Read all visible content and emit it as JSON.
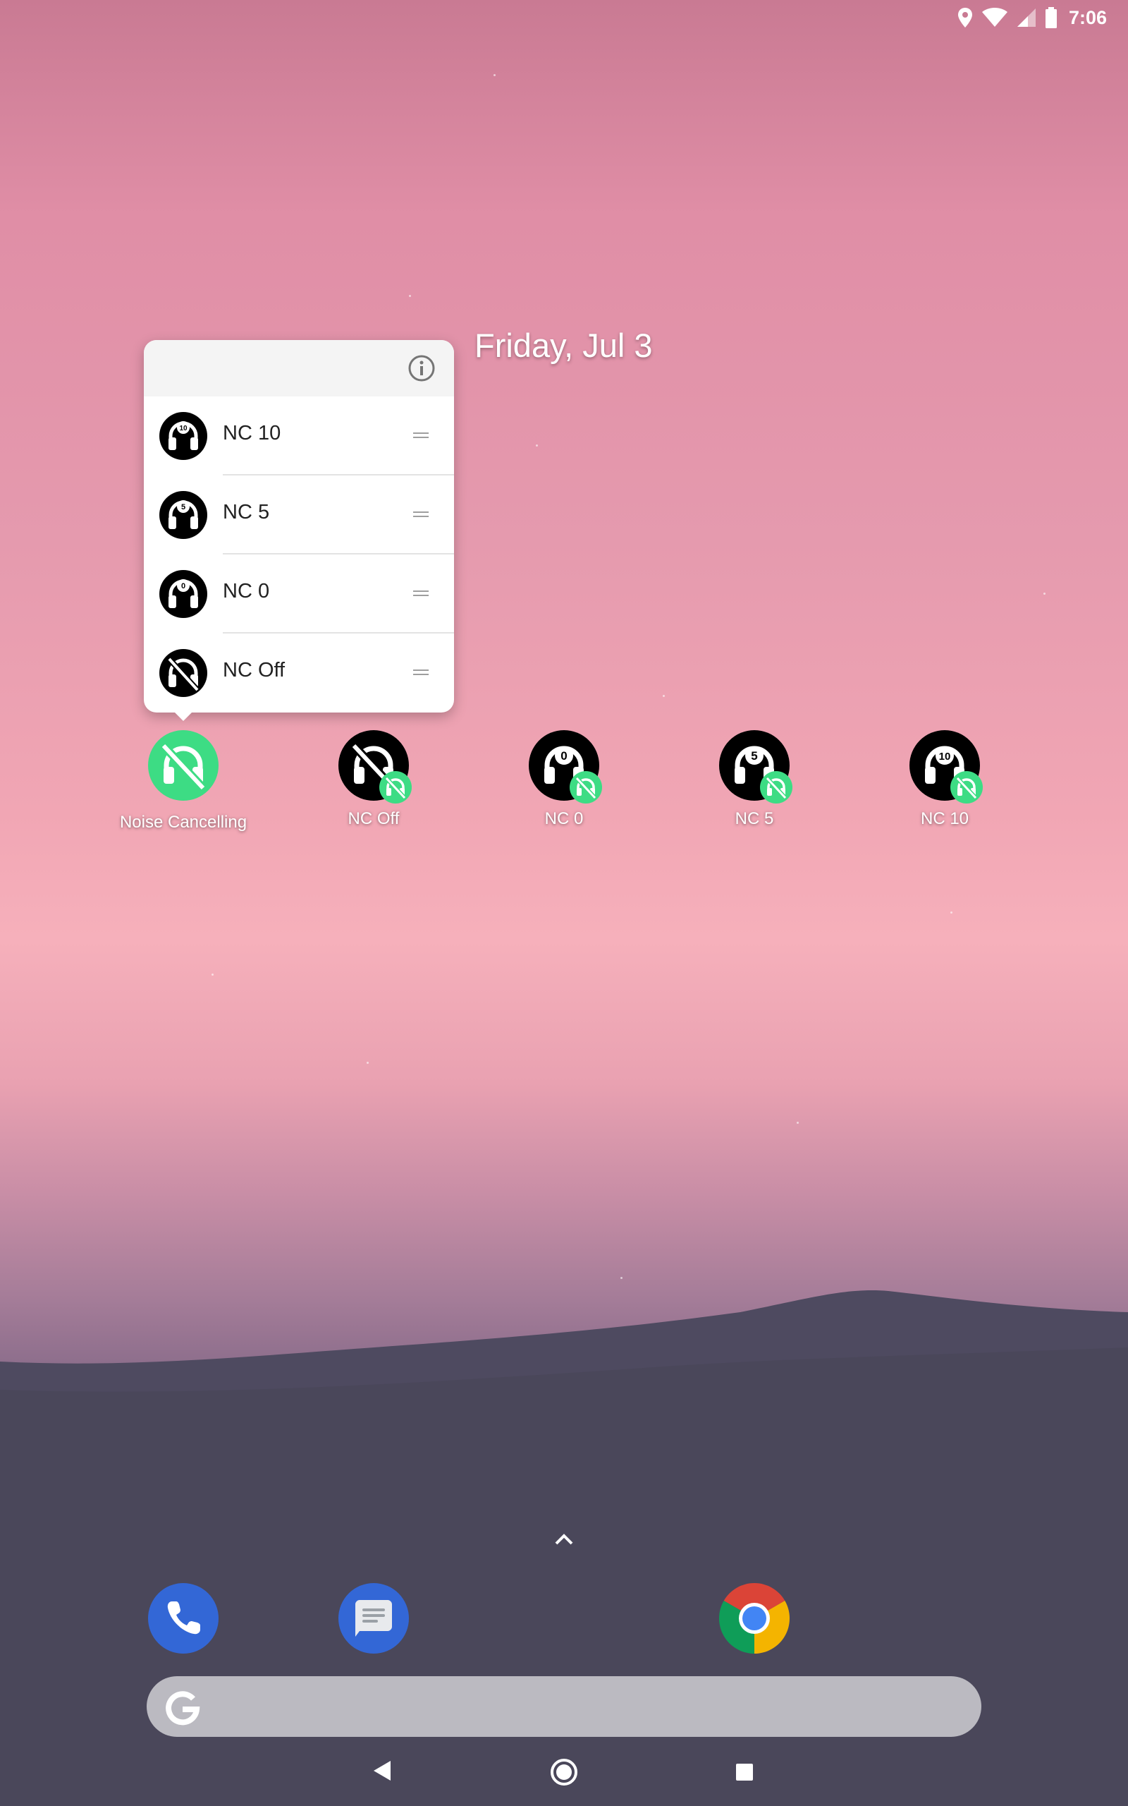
{
  "status_bar": {
    "time": "7:06"
  },
  "home": {
    "date": "Friday, Jul 3"
  },
  "popup": {
    "items": [
      {
        "label": "NC 10",
        "icon": "nc-10-icon",
        "number": "10"
      },
      {
        "label": "NC 5",
        "icon": "nc-5-icon",
        "number": "5"
      },
      {
        "label": "NC 0",
        "icon": "nc-0-icon",
        "number": "0"
      },
      {
        "label": "NC Off",
        "icon": "nc-off-icon",
        "number": ""
      }
    ]
  },
  "apps": [
    {
      "label": "Noise Cancelling",
      "icon": "noise-cancelling-app-icon"
    },
    {
      "label": "NC Off",
      "icon": "nc-off-shortcut-icon"
    },
    {
      "label": "NC 0",
      "icon": "nc-0-shortcut-icon",
      "number": "0"
    },
    {
      "label": "NC 5",
      "icon": "nc-5-shortcut-icon",
      "number": "5"
    },
    {
      "label": "NC 10",
      "icon": "nc-10-shortcut-icon",
      "number": "10"
    }
  ],
  "dock": [
    {
      "name": "phone",
      "icon": "phone-icon"
    },
    {
      "name": "messages",
      "icon": "messages-icon"
    },
    {
      "name": "chrome",
      "icon": "chrome-icon"
    }
  ],
  "colors": {
    "accent": "#3ddc84",
    "dock_blue": "#3367d6"
  }
}
